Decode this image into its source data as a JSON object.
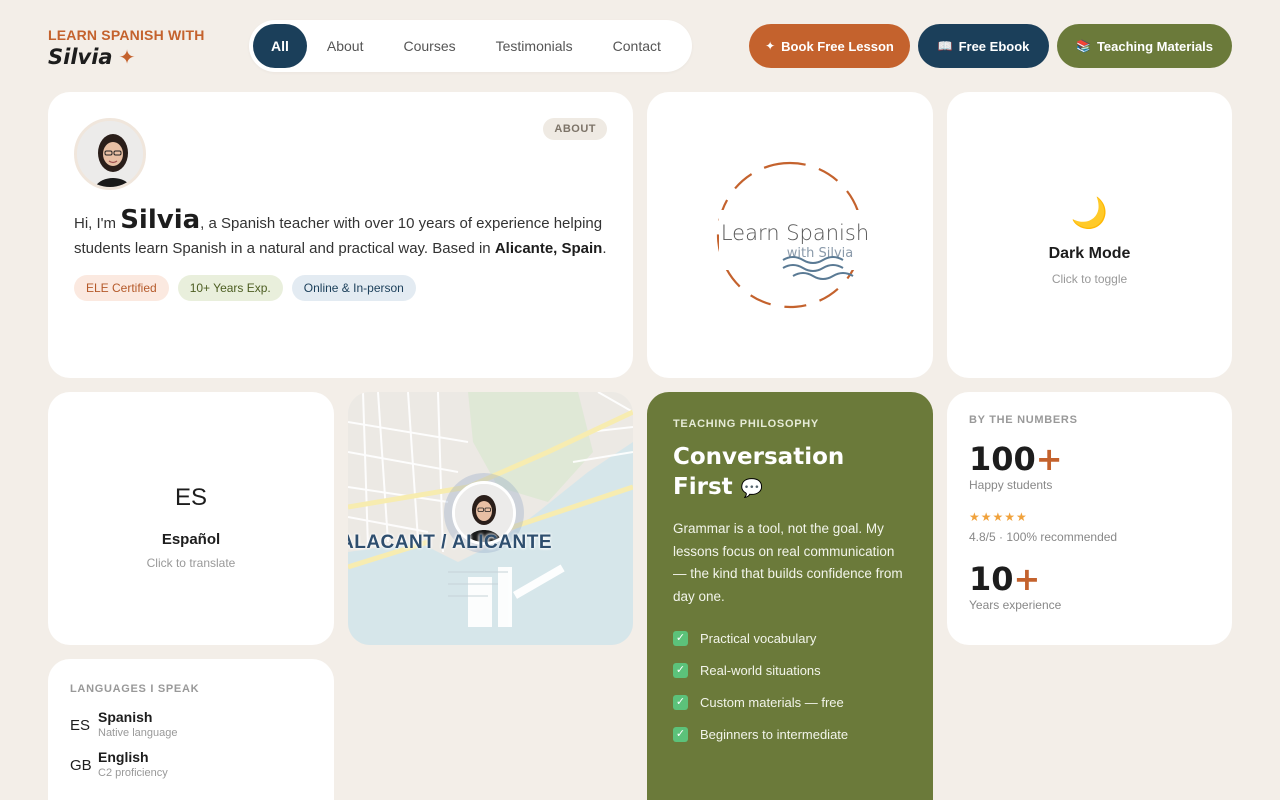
{
  "brand": {
    "top": "LEARN SPANISH WITH",
    "name": "Silvia",
    "star": "✦"
  },
  "nav": [
    {
      "label": "All",
      "active": true
    },
    {
      "label": "About",
      "active": false
    },
    {
      "label": "Courses",
      "active": false
    },
    {
      "label": "Testimonials",
      "active": false
    },
    {
      "label": "Contact",
      "active": false
    }
  ],
  "header_buttons": {
    "book": {
      "icon": "✦",
      "label": "Book Free Lesson",
      "color": "#c4622d"
    },
    "ebook": {
      "icon": "📖",
      "label": "Free Ebook",
      "color": "#1b3f5a"
    },
    "materials": {
      "icon": "📚",
      "label": "Teaching Materials",
      "color": "#6b7a3a"
    }
  },
  "about": {
    "tag": "ABOUT",
    "greeting": "Hi, I'm ",
    "name": "Silvia",
    "text1": ", a Spanish teacher with over 10 years of experience helping students learn Spanish in a natural and practical way. Based in ",
    "location": "Alicante, Spain",
    "text2": ".",
    "chips": [
      "ELE Certified",
      "10+ Years Exp.",
      "Online & In-person"
    ]
  },
  "logo": {
    "line1": "Learn Spanish",
    "line2": "with Silvia"
  },
  "dark_mode": {
    "icon": "🌙",
    "title": "Dark Mode",
    "subtitle": "Click to toggle"
  },
  "language_toggle": {
    "code": "ES",
    "title": "Español",
    "subtitle": "Click to translate"
  },
  "map": {
    "label": "ALACANT / ALICANTE"
  },
  "philosophy": {
    "kicker": "TEACHING PHILOSOPHY",
    "title_line1": "Conversation",
    "title_line2": "First",
    "bubble": "💬",
    "body": "Grammar is a tool, not the goal. My lessons focus on real communication — the kind that builds confidence from day one.",
    "items": [
      "Practical vocabulary",
      "Real-world situations",
      "Custom materials — free",
      "Beginners to intermediate"
    ],
    "check": "✓"
  },
  "numbers": {
    "kicker": "BY THE NUMBERS",
    "students_value": "100",
    "students_plus": "+",
    "students_label": "Happy students",
    "stars": "★★★★★",
    "rating": "4.8/5 · 100% recommended",
    "years_value": "10",
    "years_plus": "+",
    "years_label": "Years experience"
  },
  "languages": {
    "kicker": "LANGUAGES I SPEAK",
    "items": [
      {
        "code": "ES",
        "name": "Spanish",
        "level": "Native language"
      },
      {
        "code": "GB",
        "name": "English",
        "level": "C2 proficiency"
      }
    ]
  }
}
